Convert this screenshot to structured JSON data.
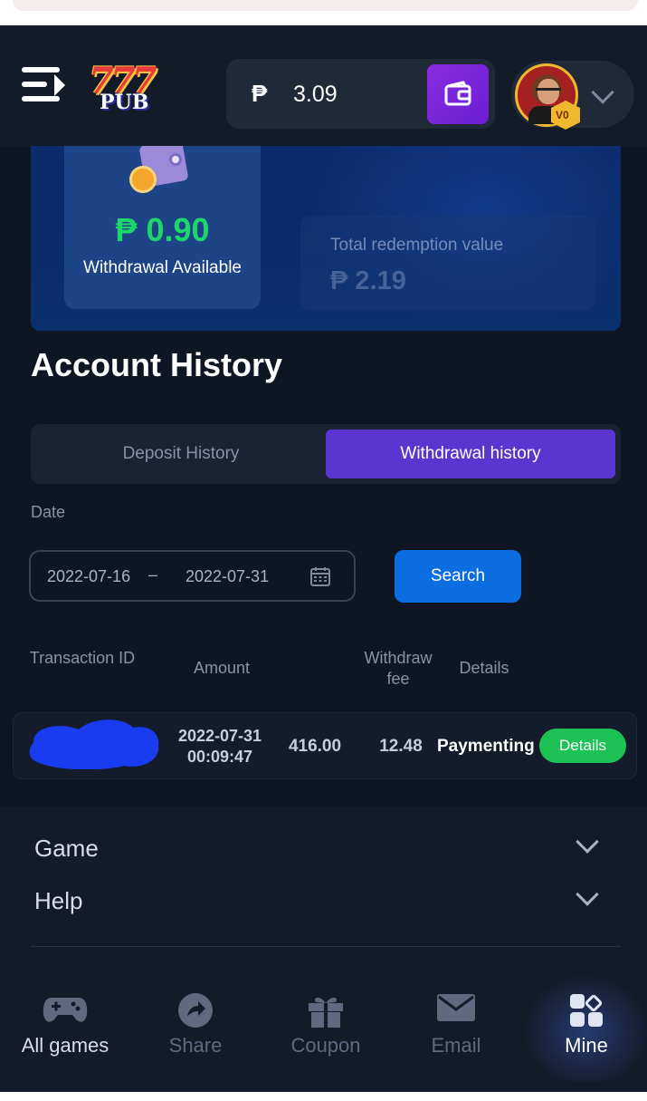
{
  "header": {
    "currency_symbol": "₱",
    "balance": "3.09",
    "vip_badge": "V0"
  },
  "summary": {
    "withdrawal_available_value": "₱ 0.90",
    "withdrawal_available_label": "Withdrawal Available",
    "total_redemption_label": "Total redemption value",
    "total_redemption_value": "₱ 2.19"
  },
  "history": {
    "title": "Account History",
    "tabs": [
      {
        "label": "Deposit History",
        "active": false
      },
      {
        "label": "Withdrawal history",
        "active": true
      }
    ],
    "date_label": "Date",
    "date_start": "2022-07-16",
    "date_separator": "–",
    "date_end": "2022-07-31",
    "search_label": "Search",
    "columns": {
      "transaction_id": "Transaction ID",
      "amount": "Amount",
      "withdraw_fee": "Withdraw fee",
      "details": "Details"
    },
    "rows": [
      {
        "datetime": "2022-07-31 00:09:47",
        "amount": "416.00",
        "fee": "12.48",
        "status": "Paymenting",
        "details_label": "Details"
      }
    ]
  },
  "footer": {
    "sections": [
      "Game",
      "Help"
    ]
  },
  "bottom_nav": [
    {
      "label": "All games",
      "icon": "gamepad-icon"
    },
    {
      "label": "Share",
      "icon": "share-icon"
    },
    {
      "label": "Coupon",
      "icon": "gift-icon"
    },
    {
      "label": "Email",
      "icon": "mail-icon"
    },
    {
      "label": "Mine",
      "icon": "grid-icon",
      "active": true
    }
  ],
  "colors": {
    "accent_purple": "#5a35cf",
    "search_blue": "#0b6de2",
    "success_green": "#1dc255",
    "available_green": "#1fd66b"
  }
}
